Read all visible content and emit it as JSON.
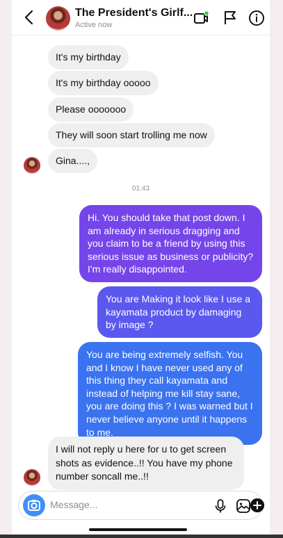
{
  "header": {
    "title": "The President's Girlf...",
    "status": "Active now"
  },
  "messages": [
    {
      "text": "It's my birthday"
    },
    {
      "text": "It's my birthday ooooo"
    },
    {
      "text": "Please ooooooo"
    },
    {
      "text": "They will soon start trolling me now"
    },
    {
      "text": "Gina....,"
    },
    {
      "text": "01:43"
    },
    {
      "text": "Hi. You should take that post down. I am already in serious dragging and you claim to be a friend by using this serious issue as business or publicity? I'm really disappointed."
    },
    {
      "text": "You are Making it look like I use a kayamata  product by damaging by image ?"
    },
    {
      "text": "You are being extremely selfish. You and I know I have never used any of this thing they call kayamata and instead of helping me kill stay sane, you are doing this ? I was warned but I never believe anyone until it happens to me."
    },
    {
      "text": "I will not reply u here for u to get screen shots as evidence..!! You have my phone number soncall me..!!"
    }
  ],
  "composer": {
    "placeholder": "Message..."
  },
  "colors": {
    "incoming_bubble": "#efefef",
    "outgoing_purple": "#7a45ea",
    "outgoing_blue": "#3a72f0",
    "online_dot": "#2ecc40",
    "camera_button": "#3f8ff7"
  },
  "icons": [
    "back-arrow-icon",
    "video-call-icon",
    "flag-icon",
    "info-icon",
    "camera-icon",
    "microphone-icon",
    "gallery-icon",
    "add-icon"
  ]
}
